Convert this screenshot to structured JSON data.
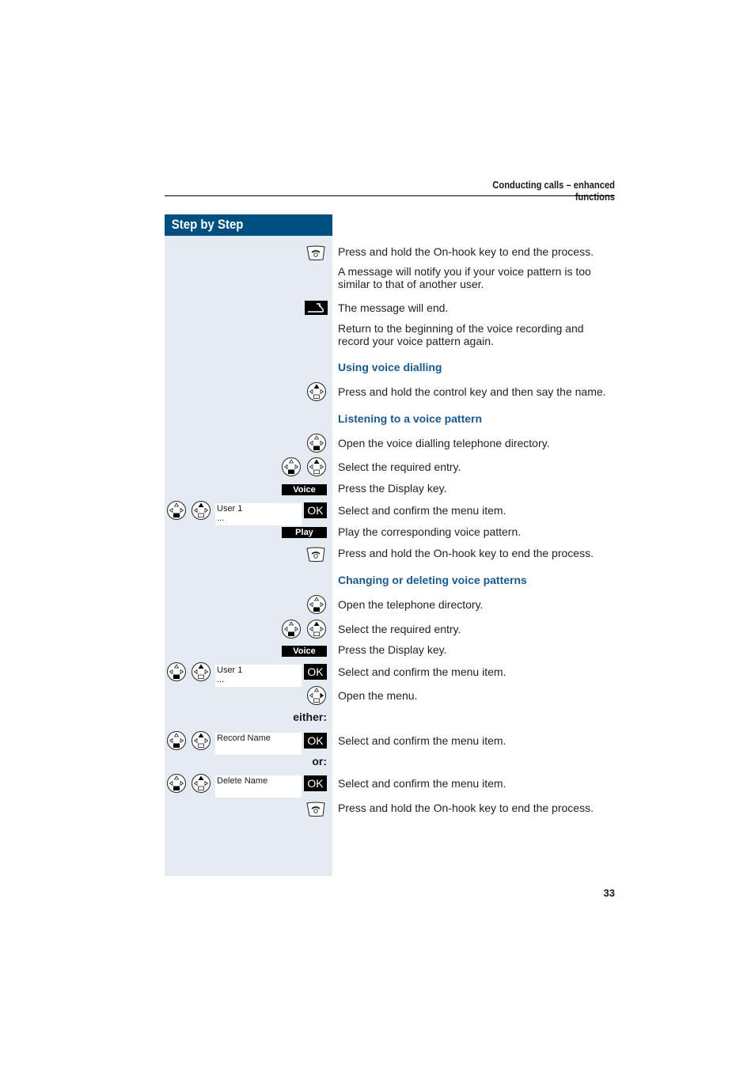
{
  "header": {
    "title": "Conducting calls – enhanced functions"
  },
  "sidebar_title": "Step by Step",
  "page_number": "33",
  "texts": {
    "t1": "Press and hold the On-hook key to end the process.",
    "t2": "A message will notify you if your voice pattern is too similar to that of another user.",
    "t3": "The message will end.",
    "t4": "Return to the beginning of the voice recording and record your voice pattern again.",
    "h1": "Using voice dialling",
    "t5": "Press and hold the control key and then say the name.",
    "h2": "Listening to a voice pattern",
    "t6": "Open the voice dialling telephone directory.",
    "t7": "Select the required entry.",
    "t8": "Press the Display key.",
    "t9": "Select and confirm the menu item.",
    "t10": "Play the corresponding voice pattern.",
    "t11": "Press and hold the On-hook key to end the process.",
    "h3": "Changing or deleting voice patterns",
    "t12": "Open the telephone directory.",
    "t13": "Select the required entry.",
    "t14": "Press the Display key.",
    "t15": "Select and confirm the menu item.",
    "t16": "Open the menu.",
    "t17": "Select and confirm the menu item.",
    "t18": "Select and confirm the menu item.",
    "t19": "Press and hold the On-hook key to end the process."
  },
  "keys": {
    "voice": "Voice",
    "play": "Play",
    "ok": "OK"
  },
  "labels": {
    "either": "either:",
    "or": "or:"
  },
  "displays": {
    "d1": {
      "line1": "User 1",
      "line2": "..."
    },
    "d2": {
      "line1": "User 1",
      "line2": "..."
    },
    "d3": {
      "line1": "Record Name",
      "line2": ""
    },
    "d4": {
      "line1": "Delete Name",
      "line2": ""
    }
  },
  "colors": {
    "brand": "#004f80",
    "heading": "#1a5a8a",
    "sidebar_bg": "#e4ebf2"
  }
}
